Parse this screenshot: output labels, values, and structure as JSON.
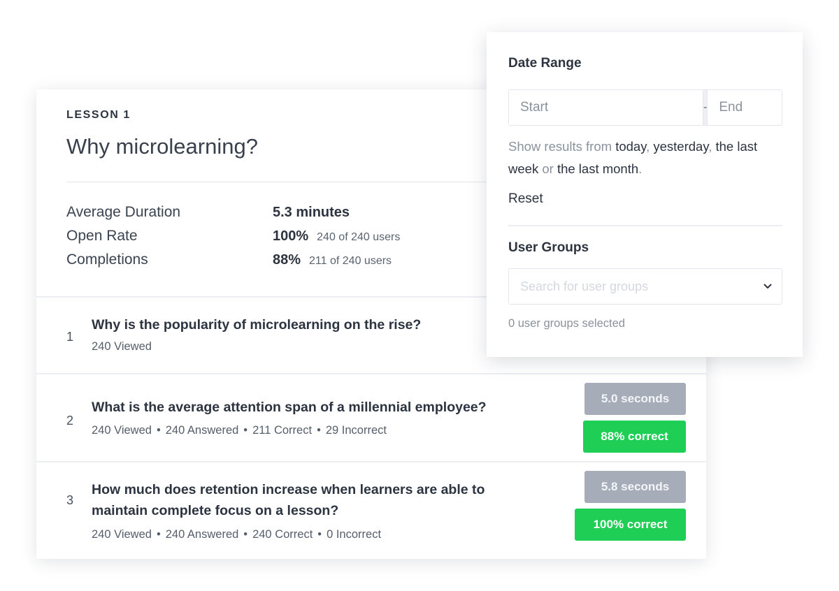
{
  "lesson": {
    "eyebrow": "LESSON 1",
    "title": "Why microlearning?"
  },
  "stats": [
    {
      "label": "Average Duration",
      "value": "5.3 minutes",
      "sub": ""
    },
    {
      "label": "Open Rate",
      "value": "100%",
      "sub": "240 of 240 users"
    },
    {
      "label": "Completions",
      "value": "88%",
      "sub": "211 of 240 users"
    }
  ],
  "questions": [
    {
      "number": "1",
      "text": "Why is the popularity of microlearning on the rise?",
      "viewed": "240 Viewed"
    },
    {
      "number": "2",
      "text": "What is the average attention span of a millennial employee?",
      "viewed": "240 Viewed",
      "answered": "240 Answered",
      "correct": "211 Correct",
      "incorrect": "29 Incorrect",
      "time": "5.0 seconds",
      "score": "88% correct"
    },
    {
      "number": "3",
      "text": "How much does retention increase when learners are able to maintain complete focus on a lesson?",
      "viewed": "240 Viewed",
      "answered": "240 Answered",
      "correct": "240 Correct",
      "incorrect": "0 Incorrect",
      "time": "5.8 seconds",
      "score": "100% correct"
    }
  ],
  "meta_separator": "•",
  "filter": {
    "date_range_heading": "Date Range",
    "start_placeholder": "Start",
    "separator": "-",
    "end_placeholder": "End",
    "show_results_prefix": "Show results from",
    "link_today": "today",
    "link_yesterday": "yesterday",
    "link_last_week": "the last week",
    "or_word": "or",
    "link_last_month": "the last month",
    "reset_label": "Reset",
    "user_groups_heading": "User Groups",
    "groups_placeholder": "Search for user groups",
    "groups_selected": "0 user groups selected"
  },
  "colors": {
    "success_green": "#1fcf55",
    "time_gray": "#a7adb8",
    "text_dark": "#2c3440",
    "text_muted": "#8a929d"
  }
}
